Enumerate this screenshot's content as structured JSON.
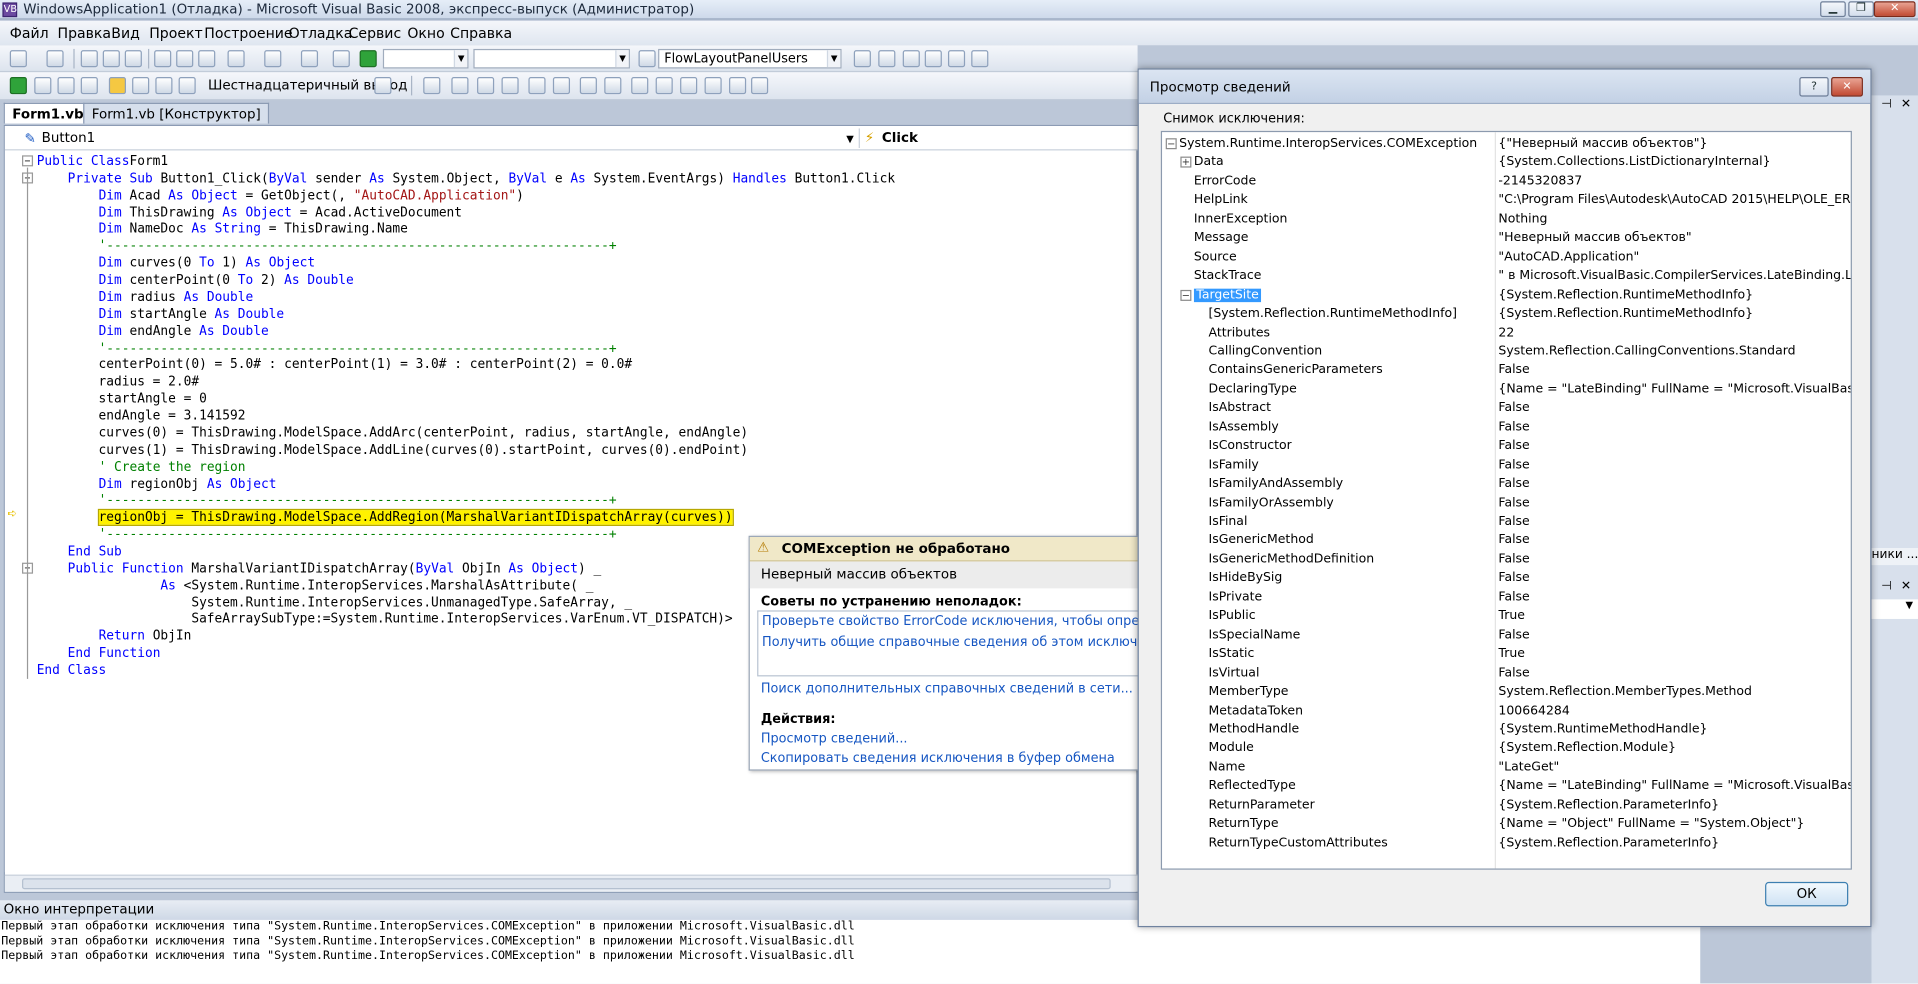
{
  "window": {
    "title": "WindowsApplication1 (Отладка) - Microsoft Visual Basic 2008, экспресс-выпуск (Администратор)",
    "icon_text": "VB"
  },
  "menu": [
    "Файл",
    "Правка",
    "Вид",
    "Проект",
    "Построение",
    "Отладка",
    "Сервис",
    "Окно",
    "Справка"
  ],
  "toolbar": {
    "object_combo": "FlowLayoutPanelUsers",
    "hex_label": "Шестнадцатеричный вывод"
  },
  "tabs": [
    "Form1.vb",
    "Form1.vb [Конструктор]"
  ],
  "editor": {
    "object_dropdown": "Button1",
    "event_dropdown": "Click",
    "lines": [
      [
        [
          "kw",
          "Public Class"
        ],
        [
          "",
          "Form1"
        ]
      ],
      [
        [
          "",
          "    "
        ],
        [
          "kw",
          "Private Sub"
        ],
        [
          "",
          " Button1_Click("
        ],
        [
          "kw",
          "ByVal"
        ],
        [
          "",
          " sender "
        ],
        [
          "kw",
          "As"
        ],
        [
          "",
          " System.Object, "
        ],
        [
          "kw",
          "ByVal"
        ],
        [
          "",
          " e "
        ],
        [
          "kw",
          "As"
        ],
        [
          "",
          " System.EventArgs) "
        ],
        [
          "kw",
          "Handles"
        ],
        [
          "",
          " Button1.Click"
        ]
      ],
      [
        [
          "",
          "        "
        ],
        [
          "kw",
          "Dim"
        ],
        [
          "",
          " Acad "
        ],
        [
          "kw",
          "As Object"
        ],
        [
          "",
          " = GetObject(, "
        ],
        [
          "str",
          "\"AutoCAD.Application\""
        ],
        [
          "",
          ")"
        ]
      ],
      [
        [
          "",
          "        "
        ],
        [
          "kw",
          "Dim"
        ],
        [
          "",
          " ThisDrawing "
        ],
        [
          "kw",
          "As Object"
        ],
        [
          "",
          " = Acad.ActiveDocument"
        ]
      ],
      [
        [
          "",
          "        "
        ],
        [
          "kw",
          "Dim"
        ],
        [
          "",
          " NameDoc "
        ],
        [
          "kw",
          "As String"
        ],
        [
          "",
          " = ThisDrawing.Name"
        ]
      ],
      [
        [
          "",
          "        "
        ],
        [
          "cm",
          "'-----------------------------------------------------------------+"
        ]
      ],
      [
        [
          "",
          "        "
        ],
        [
          "kw",
          "Dim"
        ],
        [
          "",
          " curves(0 "
        ],
        [
          "kw",
          "To"
        ],
        [
          "",
          " 1) "
        ],
        [
          "kw",
          "As Object"
        ]
      ],
      [
        [
          "",
          "        "
        ],
        [
          "kw",
          "Dim"
        ],
        [
          "",
          " centerPoint(0 "
        ],
        [
          "kw",
          "To"
        ],
        [
          "",
          " 2) "
        ],
        [
          "kw",
          "As Double"
        ]
      ],
      [
        [
          "",
          "        "
        ],
        [
          "kw",
          "Dim"
        ],
        [
          "",
          " radius "
        ],
        [
          "kw",
          "As Double"
        ]
      ],
      [
        [
          "",
          "        "
        ],
        [
          "kw",
          "Dim"
        ],
        [
          "",
          " startAngle "
        ],
        [
          "kw",
          "As Double"
        ]
      ],
      [
        [
          "",
          "        "
        ],
        [
          "kw",
          "Dim"
        ],
        [
          "",
          " endAngle "
        ],
        [
          "kw",
          "As Double"
        ]
      ],
      [
        [
          "",
          "        "
        ],
        [
          "cm",
          "'-----------------------------------------------------------------+"
        ]
      ],
      [
        [
          "",
          "        centerPoint(0) = 5.0# : centerPoint(1) = 3.0# : centerPoint(2) = 0.0#"
        ]
      ],
      [
        [
          "",
          "        radius = 2.0#"
        ]
      ],
      [
        [
          "",
          "        startAngle = 0"
        ]
      ],
      [
        [
          "",
          "        endAngle = 3.141592"
        ]
      ],
      [
        [
          "",
          "        curves(0) = ThisDrawing.ModelSpace.AddArc(centerPoint, radius, startAngle, endAngle)"
        ]
      ],
      [
        [
          "",
          "        curves(1) = ThisDrawing.ModelSpace.AddLine(curves(0).startPoint, curves(0).endPoint)"
        ]
      ],
      [
        [
          "",
          "        "
        ],
        [
          "cm",
          "' Create the region"
        ]
      ],
      [
        [
          "",
          "        "
        ],
        [
          "kw",
          "Dim"
        ],
        [
          "",
          " regionObj "
        ],
        [
          "kw",
          "As Object"
        ]
      ],
      [
        [
          "",
          "        "
        ],
        [
          "cm",
          "'-----------------------------------------------------------------+"
        ]
      ],
      [
        [
          "",
          "        "
        ],
        [
          "hl",
          "regionObj = ThisDrawing.ModelSpace.AddRegion(MarshalVariantIDispatchArray(curves))"
        ]
      ],
      [
        [
          "",
          "        "
        ],
        [
          "cm",
          "'-----------------------------------------------------------------+"
        ]
      ],
      [
        [
          "",
          "    "
        ],
        [
          "kw",
          "End Sub"
        ]
      ],
      [
        [
          "",
          "    "
        ],
        [
          "kw",
          "Public Function"
        ],
        [
          "",
          " MarshalVariantIDispatchArray("
        ],
        [
          "kw",
          "ByVal"
        ],
        [
          "",
          " ObjIn "
        ],
        [
          "kw",
          "As Object"
        ],
        [
          "",
          ") _"
        ]
      ],
      [
        [
          "",
          "                "
        ],
        [
          "kw",
          "As"
        ],
        [
          "",
          " <System.Runtime.InteropServices.MarshalAsAttribute( _"
        ]
      ],
      [
        [
          "",
          "                    System.Runtime.InteropServices.UnmanagedType.SafeArray, _"
        ]
      ],
      [
        [
          "",
          "                    SafeArraySubType:=System.Runtime.InteropServices.VarEnum.VT_DISPATCH)>"
        ]
      ],
      [
        [
          "",
          "        "
        ],
        [
          "kw",
          "Return"
        ],
        [
          "",
          " ObjIn"
        ]
      ],
      [
        [
          "",
          "    "
        ],
        [
          "kw",
          "End Function"
        ]
      ],
      [
        [
          "kw",
          "End Class"
        ]
      ]
    ]
  },
  "exception_popup": {
    "title": "COMException не обработано",
    "message": "Неверный массив объектов",
    "tips_header": "Советы по устранению неполадок:",
    "tip1": "Проверьте свойство ErrorCode исключения, чтобы определить HRES",
    "tip2": "Получить общие справочные сведения об этом исключении.",
    "search_link": "Поиск дополнительных справочных сведений в сети...",
    "actions_header": "Действия:",
    "action1": "Просмотр сведений...",
    "action2": "Скопировать сведения исключения в буфер обмена"
  },
  "immediate": {
    "title": "Окно интерпретации",
    "lines": [
      "Первый этап обработки исключения типа \"System.Runtime.InteropServices.COMException\" в приложении Microsoft.VisualBasic.dll",
      "Первый этап обработки исключения типа \"System.Runtime.InteropServices.COMException\" в приложении Microsoft.VisualBasic.dll",
      "Первый этап обработки исключения типа \"System.Runtime.InteropServices.COMException\" в приложении Microsoft.VisualBasic.dll"
    ]
  },
  "right_strip": {
    "text1": "ники ...",
    "text2": "▼"
  },
  "dialog": {
    "title": "Просмотр сведений",
    "help_label": "?",
    "close_label": "✕",
    "snapshot_label": "Снимок исключения:",
    "ok_label": "ОК",
    "rows": [
      {
        "name": "System.Runtime.InteropServices.COMException",
        "value": "{\"Неверный массив объектов\"}",
        "level": 0,
        "toggle": "-"
      },
      {
        "name": "Data",
        "value": "{System.Collections.ListDictionaryInternal}",
        "level": 1,
        "toggle": "+"
      },
      {
        "name": "ErrorCode",
        "value": "-2145320837",
        "level": 1
      },
      {
        "name": "HelpLink",
        "value": "\"C:\\Program Files\\Autodesk\\AutoCAD 2015\\HELP\\OLE_ERR.CHM#",
        "level": 1
      },
      {
        "name": "InnerException",
        "value": "Nothing",
        "level": 1
      },
      {
        "name": "Message",
        "value": "\"Неверный массив объектов\"",
        "level": 1
      },
      {
        "name": "Source",
        "value": "\"AutoCAD.Application\"",
        "level": 1
      },
      {
        "name": "StackTrace",
        "value": "\"   в Microsoft.VisualBasic.CompilerServices.LateBinding.LateGet(O",
        "level": 1
      },
      {
        "name": "TargetSite",
        "value": "{System.Reflection.RuntimeMethodInfo}",
        "level": 1,
        "toggle": "-",
        "selected": true
      },
      {
        "name": "[System.Reflection.RuntimeMethodInfo]",
        "value": "{System.Reflection.RuntimeMethodInfo}",
        "level": 2
      },
      {
        "name": "Attributes",
        "value": "22",
        "level": 2
      },
      {
        "name": "CallingConvention",
        "value": "System.Reflection.CallingConventions.Standard",
        "level": 2
      },
      {
        "name": "ContainsGenericParameters",
        "value": "False",
        "level": 2
      },
      {
        "name": "DeclaringType",
        "value": "{Name = \"LateBinding\" FullName = \"Microsoft.VisualBasic.Compile",
        "level": 2
      },
      {
        "name": "IsAbstract",
        "value": "False",
        "level": 2
      },
      {
        "name": "IsAssembly",
        "value": "False",
        "level": 2
      },
      {
        "name": "IsConstructor",
        "value": "False",
        "level": 2
      },
      {
        "name": "IsFamily",
        "value": "False",
        "level": 2
      },
      {
        "name": "IsFamilyAndAssembly",
        "value": "False",
        "level": 2
      },
      {
        "name": "IsFamilyOrAssembly",
        "value": "False",
        "level": 2
      },
      {
        "name": "IsFinal",
        "value": "False",
        "level": 2
      },
      {
        "name": "IsGenericMethod",
        "value": "False",
        "level": 2
      },
      {
        "name": "IsGenericMethodDefinition",
        "value": "False",
        "level": 2
      },
      {
        "name": "IsHideBySig",
        "value": "False",
        "level": 2
      },
      {
        "name": "IsPrivate",
        "value": "False",
        "level": 2
      },
      {
        "name": "IsPublic",
        "value": "True",
        "level": 2
      },
      {
        "name": "IsSpecialName",
        "value": "False",
        "level": 2
      },
      {
        "name": "IsStatic",
        "value": "True",
        "level": 2
      },
      {
        "name": "IsVirtual",
        "value": "False",
        "level": 2
      },
      {
        "name": "MemberType",
        "value": "System.Reflection.MemberTypes.Method",
        "level": 2
      },
      {
        "name": "MetadataToken",
        "value": "100664284",
        "level": 2
      },
      {
        "name": "MethodHandle",
        "value": "{System.RuntimeMethodHandle}",
        "level": 2
      },
      {
        "name": "Module",
        "value": "{System.Reflection.Module}",
        "level": 2
      },
      {
        "name": "Name",
        "value": "\"LateGet\"",
        "level": 2
      },
      {
        "name": "ReflectedType",
        "value": "{Name = \"LateBinding\" FullName = \"Microsoft.VisualBasic.Compile",
        "level": 2
      },
      {
        "name": "ReturnParameter",
        "value": "{System.Reflection.ParameterInfo}",
        "level": 2
      },
      {
        "name": "ReturnType",
        "value": "{Name = \"Object\" FullName = \"System.Object\"}",
        "level": 2
      },
      {
        "name": "ReturnTypeCustomAttributes",
        "value": "{System.Reflection.ParameterInfo}",
        "level": 2
      }
    ]
  }
}
